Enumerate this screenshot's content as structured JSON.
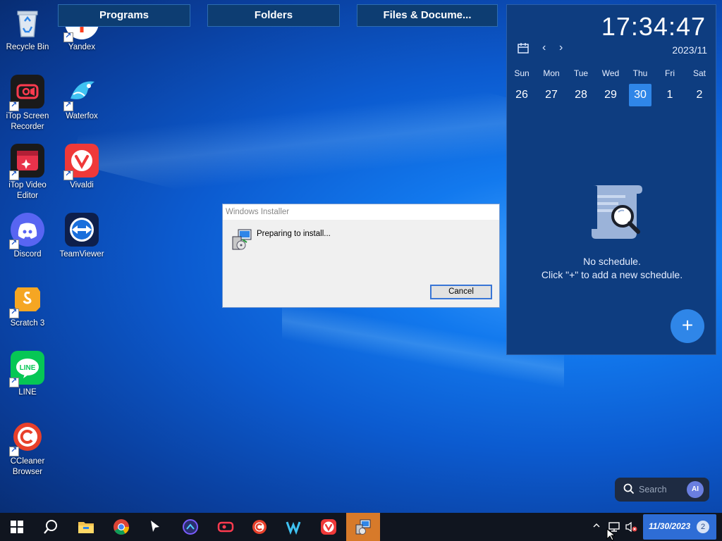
{
  "desktop_icons": [
    {
      "label": "Recycle Bin",
      "icon": "recycle-bin-icon"
    },
    {
      "label": "Yandex",
      "icon": "yandex-icon"
    },
    {
      "label": "iTop Screen Recorder",
      "icon": "itop-screen-recorder-icon"
    },
    {
      "label": "Waterfox",
      "icon": "waterfox-icon"
    },
    {
      "label": "iTop Video Editor",
      "icon": "itop-video-editor-icon"
    },
    {
      "label": "Vivaldi",
      "icon": "vivaldi-icon"
    },
    {
      "label": "Discord",
      "icon": "discord-icon"
    },
    {
      "label": "TeamViewer",
      "icon": "teamviewer-icon"
    },
    {
      "label": "Scratch 3",
      "icon": "scratch-icon"
    },
    {
      "label": "LINE",
      "icon": "line-icon"
    },
    {
      "label": "CCleaner Browser",
      "icon": "ccleaner-browser-icon"
    }
  ],
  "topbar": {
    "programs": "Programs",
    "folders": "Folders",
    "files": "Files & Docume..."
  },
  "calendar": {
    "clock": "17:34:47",
    "month": "2023/11",
    "weekdays": [
      "Sun",
      "Mon",
      "Tue",
      "Wed",
      "Thu",
      "Fri",
      "Sat"
    ],
    "dates": [
      "26",
      "27",
      "28",
      "29",
      "30",
      "1",
      "2"
    ],
    "selected_index": 4,
    "empty_line1": "No schedule.",
    "empty_line2": "Click \"+\" to add a new schedule.",
    "add_label": "+"
  },
  "dialog": {
    "title": "Windows Installer",
    "message": "Preparing to install...",
    "cancel": "Cancel"
  },
  "search": {
    "label": "Search",
    "ai": "AI"
  },
  "taskbar": {
    "date": "11/30/2023",
    "notifications": "2"
  },
  "colors": {
    "accent": "#2f86e8",
    "taskbar": "#10151f",
    "active_task": "#d77a2a"
  }
}
